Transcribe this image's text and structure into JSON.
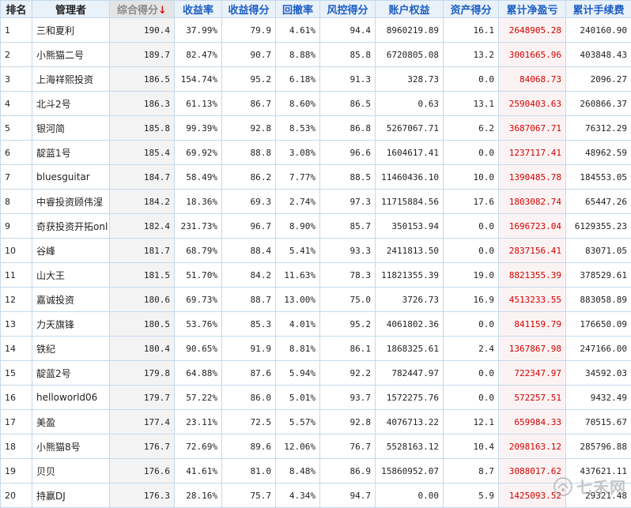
{
  "header": {
    "rank": "排名",
    "manager": "管理者",
    "composite_score": "综合得分",
    "sort_arrow": "↓",
    "return_rate": "收益率",
    "return_score": "收益得分",
    "drawdown": "回撤率",
    "risk_score": "风控得分",
    "equity": "账户权益",
    "asset_score": "资产得分",
    "net_profit": "累计净盈亏",
    "fees": "累计手续费"
  },
  "rows": [
    {
      "rank": "1",
      "name": "三和夏利",
      "score": "190.4",
      "ret": "37.99%",
      "ret_score": "79.9",
      "dd": "4.61%",
      "risk": "94.4",
      "equity": "8960219.89",
      "asset": "16.1",
      "profit": "2648905.28",
      "fee": "240160.90"
    },
    {
      "rank": "2",
      "name": "小熊猫二号",
      "score": "189.7",
      "ret": "82.47%",
      "ret_score": "90.7",
      "dd": "8.88%",
      "risk": "85.8",
      "equity": "6720805.08",
      "asset": "13.2",
      "profit": "3001665.96",
      "fee": "403848.43"
    },
    {
      "rank": "3",
      "name": "上海祥熙投资",
      "score": "186.5",
      "ret": "154.74%",
      "ret_score": "95.2",
      "dd": "6.18%",
      "risk": "91.3",
      "equity": "328.73",
      "asset": "0.0",
      "profit": "84068.73",
      "fee": "2096.27"
    },
    {
      "rank": "4",
      "name": "北斗2号",
      "score": "186.3",
      "ret": "61.13%",
      "ret_score": "86.7",
      "dd": "8.60%",
      "risk": "86.5",
      "equity": "0.63",
      "asset": "13.1",
      "profit": "2590403.63",
      "fee": "260866.37"
    },
    {
      "rank": "5",
      "name": "银河简",
      "score": "185.8",
      "ret": "99.39%",
      "ret_score": "92.8",
      "dd": "8.53%",
      "risk": "86.8",
      "equity": "5267067.71",
      "asset": "6.2",
      "profit": "3687067.71",
      "fee": "76312.29"
    },
    {
      "rank": "6",
      "name": "靛蓝1号",
      "score": "185.4",
      "ret": "69.92%",
      "ret_score": "88.8",
      "dd": "3.08%",
      "risk": "96.6",
      "equity": "1604617.41",
      "asset": "0.0",
      "profit": "1237117.41",
      "fee": "48962.59"
    },
    {
      "rank": "7",
      "name": "bluesguitar",
      "score": "184.7",
      "ret": "58.49%",
      "ret_score": "86.2",
      "dd": "7.77%",
      "risk": "88.5",
      "equity": "11460436.10",
      "asset": "10.0",
      "profit": "1390485.78",
      "fee": "184553.05"
    },
    {
      "rank": "8",
      "name": "中睿投资顾伟湦",
      "score": "184.2",
      "ret": "18.36%",
      "ret_score": "69.3",
      "dd": "2.74%",
      "risk": "97.3",
      "equity": "11715884.56",
      "asset": "17.6",
      "profit": "1803082.74",
      "fee": "65447.26"
    },
    {
      "rank": "9",
      "name": "奇获投资开拓onl",
      "score": "182.4",
      "ret": "231.73%",
      "ret_score": "96.7",
      "dd": "8.90%",
      "risk": "85.7",
      "equity": "350153.94",
      "asset": "0.0",
      "profit": "1696723.04",
      "fee": "6129355.23"
    },
    {
      "rank": "10",
      "name": "谷峰",
      "score": "181.7",
      "ret": "68.79%",
      "ret_score": "88.4",
      "dd": "5.41%",
      "risk": "93.3",
      "equity": "2411813.50",
      "asset": "0.0",
      "profit": "2837156.41",
      "fee": "83071.05"
    },
    {
      "rank": "11",
      "name": "山大王",
      "score": "181.5",
      "ret": "51.70%",
      "ret_score": "84.2",
      "dd": "11.63%",
      "risk": "78.3",
      "equity": "11821355.39",
      "asset": "19.0",
      "profit": "8821355.39",
      "fee": "378529.61"
    },
    {
      "rank": "12",
      "name": "嘉诚投资",
      "score": "180.6",
      "ret": "69.73%",
      "ret_score": "88.7",
      "dd": "13.00%",
      "risk": "75.0",
      "equity": "3726.73",
      "asset": "16.9",
      "profit": "4513233.55",
      "fee": "883058.89"
    },
    {
      "rank": "13",
      "name": "力天旗锋",
      "score": "180.5",
      "ret": "53.76%",
      "ret_score": "85.3",
      "dd": "4.01%",
      "risk": "95.2",
      "equity": "4061802.36",
      "asset": "0.0",
      "profit": "841159.79",
      "fee": "176650.09"
    },
    {
      "rank": "14",
      "name": "铁纪",
      "score": "180.4",
      "ret": "90.65%",
      "ret_score": "91.9",
      "dd": "8.81%",
      "risk": "86.1",
      "equity": "1868325.61",
      "asset": "2.4",
      "profit": "1367867.98",
      "fee": "247166.00"
    },
    {
      "rank": "15",
      "name": "靛蓝2号",
      "score": "179.8",
      "ret": "64.88%",
      "ret_score": "87.6",
      "dd": "5.94%",
      "risk": "92.2",
      "equity": "782447.97",
      "asset": "0.0",
      "profit": "722347.97",
      "fee": "34592.03"
    },
    {
      "rank": "16",
      "name": "helloworld06",
      "score": "179.7",
      "ret": "57.22%",
      "ret_score": "86.0",
      "dd": "5.01%",
      "risk": "93.7",
      "equity": "1572275.76",
      "asset": "0.0",
      "profit": "572257.51",
      "fee": "9432.49"
    },
    {
      "rank": "17",
      "name": "美盈",
      "score": "177.4",
      "ret": "23.11%",
      "ret_score": "72.5",
      "dd": "5.57%",
      "risk": "92.8",
      "equity": "4076713.22",
      "asset": "12.1",
      "profit": "659984.33",
      "fee": "70515.67"
    },
    {
      "rank": "18",
      "name": "小熊猫8号",
      "score": "176.7",
      "ret": "72.69%",
      "ret_score": "89.6",
      "dd": "12.06%",
      "risk": "76.7",
      "equity": "5528163.12",
      "asset": "10.4",
      "profit": "2098163.12",
      "fee": "285796.88"
    },
    {
      "rank": "19",
      "name": "贝贝",
      "score": "176.6",
      "ret": "41.61%",
      "ret_score": "81.0",
      "dd": "8.48%",
      "risk": "86.9",
      "equity": "15860952.07",
      "asset": "8.7",
      "profit": "3088017.62",
      "fee": "437621.11"
    },
    {
      "rank": "20",
      "name": "持赢DJ",
      "score": "176.3",
      "ret": "28.16%",
      "ret_score": "75.7",
      "dd": "4.34%",
      "risk": "94.7",
      "equity": "0.00",
      "asset": "5.9",
      "profit": "1425093.52",
      "fee": "29321.48"
    }
  ],
  "watermark": {
    "text": "七禾网",
    "icon": "qihe-logo-icon",
    "color": "#9a9a9a"
  },
  "colors": {
    "header_link": "#1c5ec4",
    "profit_red": "#d40000",
    "grid": "#c5d9ea"
  }
}
